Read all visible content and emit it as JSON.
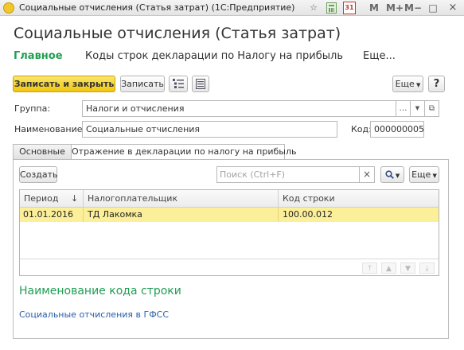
{
  "window": {
    "title": "Социальные отчисления (Статья затрат)  (1С:Предприятие)",
    "m_label": "M",
    "m_plus_label": "M+",
    "m_minus_label": "M−",
    "calendar_day": "31"
  },
  "form": {
    "title": "Социальные отчисления (Статья затрат)"
  },
  "nav": {
    "main": "Главное",
    "codes": "Коды строк декларации по Налогу на прибыль",
    "more": "Еще..."
  },
  "toolbar": {
    "save_close": "Записать и закрыть",
    "save": "Записать",
    "more": "Еще",
    "help": "?"
  },
  "fields": {
    "group_label": "Группа:",
    "group_value": "Налоги и отчисления",
    "name_label": "Наименование:",
    "name_value": "Социальные отчисления",
    "code_label": "Код:",
    "code_value": "000000005"
  },
  "tabs": [
    {
      "label": "Основные"
    },
    {
      "label": "Отражение в декларации по налогу на прибыль"
    }
  ],
  "table_toolbar": {
    "create": "Создать",
    "search_placeholder": "Поиск (Ctrl+F)",
    "clear": "×",
    "more": "Еще"
  },
  "table": {
    "columns": [
      "Период",
      "Налогоплательщик",
      "Код строки"
    ],
    "sort_arrow": "↓",
    "rows": [
      {
        "period": "01.01.2016",
        "payer": "ТД Лакомка",
        "code": "100.00.012"
      }
    ]
  },
  "details": {
    "heading": "Наименование кода строки",
    "link": "Социальные отчисления в ГФСС"
  },
  "colors": {
    "accent_green": "#1f9e53",
    "link_blue": "#2a5ea8",
    "selected_row": "#fbef9a",
    "primary_button": "#f1c60e"
  }
}
